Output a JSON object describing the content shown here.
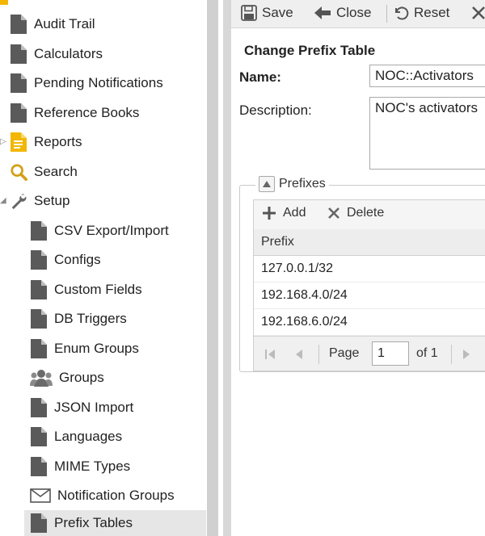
{
  "sidebar": {
    "items": [
      {
        "label": "Audit Trail",
        "icon": "document-icon"
      },
      {
        "label": "Calculators",
        "icon": "document-icon"
      },
      {
        "label": "Pending Notifications",
        "icon": "document-icon"
      },
      {
        "label": "Reference Books",
        "icon": "document-icon"
      },
      {
        "label": "Reports",
        "icon": "report-icon"
      },
      {
        "label": "Search",
        "icon": "search-icon"
      },
      {
        "label": "Setup",
        "icon": "wrench-icon"
      },
      {
        "label": "CSV Export/Import",
        "icon": "document-icon"
      },
      {
        "label": "Configs",
        "icon": "document-icon"
      },
      {
        "label": "Custom Fields",
        "icon": "document-icon"
      },
      {
        "label": "DB Triggers",
        "icon": "document-icon"
      },
      {
        "label": "Enum Groups",
        "icon": "document-icon"
      },
      {
        "label": "Groups",
        "icon": "group-icon"
      },
      {
        "label": "JSON Import",
        "icon": "document-icon"
      },
      {
        "label": "Languages",
        "icon": "document-icon"
      },
      {
        "label": "MIME Types",
        "icon": "document-icon"
      },
      {
        "label": "Notification Groups",
        "icon": "envelope-icon"
      },
      {
        "label": "Prefix Tables",
        "icon": "document-icon"
      }
    ],
    "selected": "Prefix Tables"
  },
  "toolbar": {
    "save_label": "Save",
    "close_label": "Close",
    "reset_label": "Reset"
  },
  "form": {
    "title": "Change Prefix Table",
    "name_label": "Name:",
    "name_value": "NOC::Activators",
    "description_label": "Description:",
    "description_value": "NOC's activators"
  },
  "prefixes": {
    "legend": "Prefixes",
    "add_label": "Add",
    "delete_label": "Delete",
    "column_header": "Prefix",
    "rows": [
      "127.0.0.1/32",
      "192.168.4.0/24",
      "192.168.6.0/24"
    ],
    "pager": {
      "page_label": "Page",
      "page_value": "1",
      "of_label": "of 1"
    }
  },
  "colors": {
    "accent_icon": "#f2b705",
    "search_icon": "#d4a017",
    "doc_icon": "#5a5a5a",
    "selected_row": "#e6e6e6"
  }
}
